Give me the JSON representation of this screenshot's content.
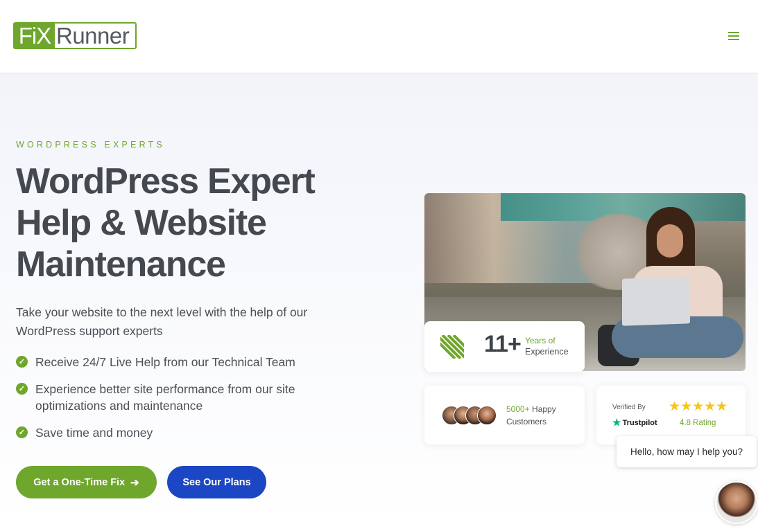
{
  "header": {
    "logo_part1": "FiX",
    "logo_part2": "Runner",
    "menu_icon": "hamburger-icon"
  },
  "hero": {
    "eyebrow": "WORDPRESS EXPERTS",
    "title_lines": [
      "WordPress Expert",
      "Help & Website",
      "Maintenance"
    ],
    "subtitle": "Take your website to the next level with the help of our WordPress support experts",
    "features": [
      "Receive 24/7 Live Help from our Technical Team",
      "Experience better site performance from our site optimizations and maintenance",
      "Save time and money"
    ],
    "cta_primary": "Get a One-Time Fix",
    "cta_primary_icon": "arrow-right-icon",
    "cta_secondary": "See Our Plans"
  },
  "stats": {
    "years_number": "11+",
    "years_label_1": "Years of",
    "years_label_2": "Experience",
    "customers_count": "5000+",
    "customers_label_1": "Happy",
    "customers_label_2": "Customers",
    "verified_by": "Verified By",
    "trustpilot": "Trustpilot",
    "stars": "★★★★★",
    "rating": "4.8 Rating"
  },
  "chat": {
    "bubble_text": "Hello, how may I help you?"
  },
  "colors": {
    "brand_green": "#6fa62c",
    "brand_blue": "#1b47c4",
    "star_yellow": "#f5c518",
    "trustpilot_green": "#00b67a"
  }
}
